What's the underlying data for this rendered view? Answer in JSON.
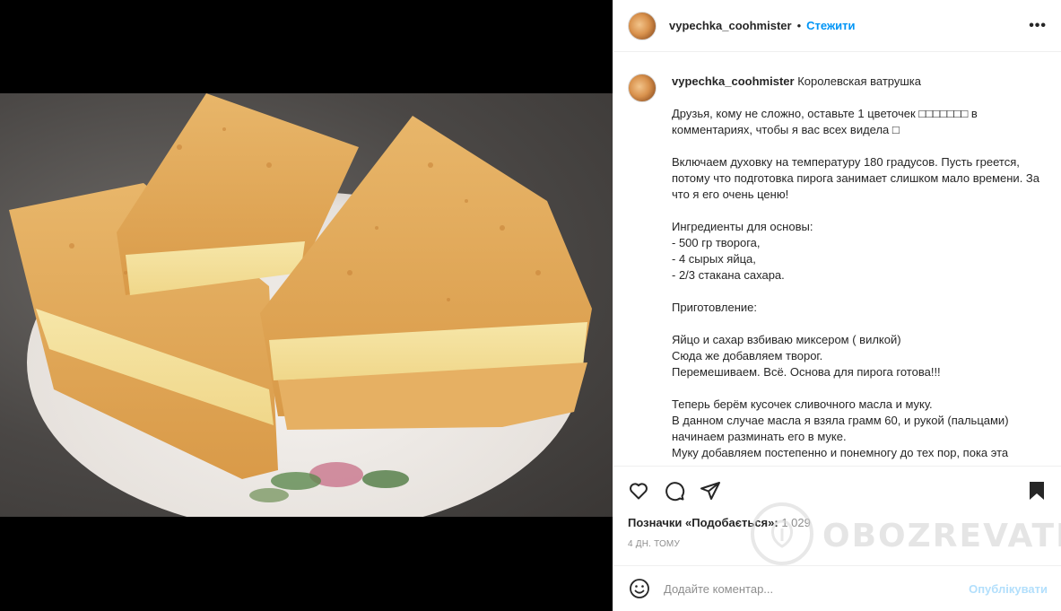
{
  "post": {
    "username": "vypechka_coohmister",
    "follow_label": "Стежити",
    "more_label": "•••",
    "caption_title": "Королевская ватрушка",
    "caption_paragraphs": [
      "Друзья, кому не сложно, оставьте 1 цветочек □□□□□□□ в комментариях, чтобы я вас всех видела □",
      "Включаем духовку на температуру 180 градусов. Пусть греется, потому что подготовка пирога занимает слишком мало времени. За что я его очень ценю!",
      "Ингредиенты для основы:\n- 500 гр творога,\n- 4 сырых яйца,\n- 2/3 стакана сахара.",
      "Приготовление:",
      "Яйцо и сахар взбиваю миксером ( вилкой)\nСюда же добавляем творог.\nПеремешиваем. Всё. Основа для пирога готова!!!",
      "Теперь берём кусочек сливочного масла и муку.\nВ данном случае масла я взяла грамм 60, и рукой (пальцами) начинаем разминать его в муке.\nМуку добавляем постепенно и понемногу до тех пор, пока эта"
    ],
    "likes_prefix": "Позначки «Подобається»:",
    "likes_count": "1 029",
    "time_ago": "4 ДН. ТОМУ",
    "comment_placeholder": "Додайте коментар...",
    "publish_label": "Опублікувати"
  },
  "watermark": {
    "text": "OBOZREVATEL"
  },
  "icons": {
    "like": "heart-icon",
    "comment": "comment-icon",
    "share": "paper-plane-icon",
    "save": "bookmark-icon",
    "emoji": "smiley-icon"
  },
  "colors": {
    "link": "#0095f6",
    "publish_disabled": "#b2dffc",
    "muted": "#8e8e8e"
  }
}
